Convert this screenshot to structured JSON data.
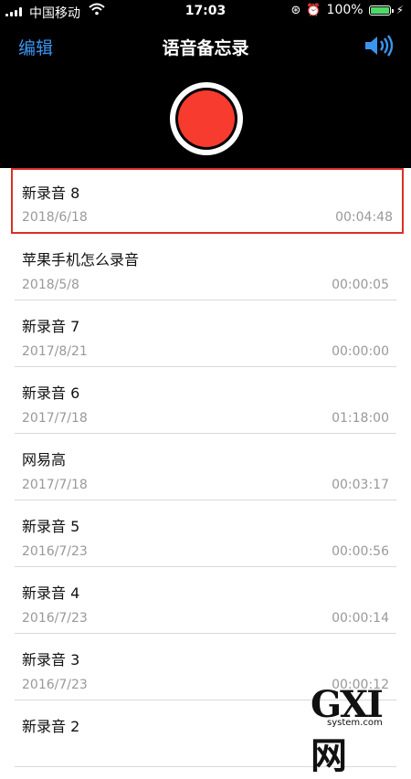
{
  "status": {
    "carrier": "中国移动",
    "time": "17:03",
    "battery_pct": "100%",
    "lock_glyph": "⊛",
    "alarm_glyph": "⏰",
    "charging_glyph": "⚡",
    "battery_level": 1.0
  },
  "nav": {
    "edit": "编辑",
    "title": "语音备忘录"
  },
  "colors": {
    "accent": "#3a95f0",
    "record": "#f83b2f",
    "highlight": "#d93025",
    "battery": "#4cd964"
  },
  "recordings": [
    {
      "name": "新录音 8",
      "date": "2018/6/18",
      "duration": "00:04:48"
    },
    {
      "name": "苹果手机怎么录音",
      "date": "2018/5/8",
      "duration": "00:00:05"
    },
    {
      "name": "新录音 7",
      "date": "2017/8/21",
      "duration": "00:00:00"
    },
    {
      "name": "新录音 6",
      "date": "2017/7/18",
      "duration": "01:18:00"
    },
    {
      "name": "网易高",
      "date": "2017/7/18",
      "duration": "00:03:17"
    },
    {
      "name": "新录音 5",
      "date": "2016/7/23",
      "duration": "00:00:56"
    },
    {
      "name": "新录音 4",
      "date": "2016/7/23",
      "duration": "00:00:14"
    },
    {
      "name": "新录音 3",
      "date": "2016/7/23",
      "duration": "00:00:12"
    },
    {
      "name": "新录音 2",
      "date": "",
      "duration": ""
    }
  ],
  "watermark": {
    "brand": "GXI网",
    "site": "system.com"
  }
}
